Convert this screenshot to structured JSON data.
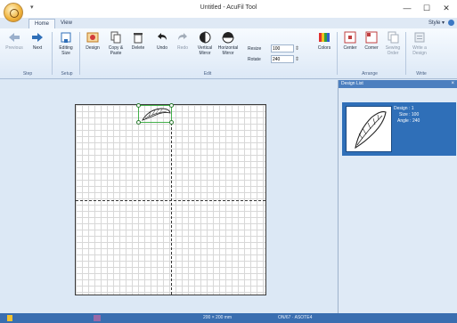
{
  "window": {
    "title": "Untitled - AcuFil Tool",
    "qat": "▾",
    "minimize": "—",
    "maximize": "☐",
    "close": "✕"
  },
  "tabs": [
    {
      "label": "Home"
    },
    {
      "label": "View"
    }
  ],
  "style_menu": "Style ▾",
  "ribbon": {
    "buttons": [
      {
        "label": "Previous",
        "disabled": true
      },
      {
        "label": "Next"
      },
      {
        "label": "Editing Size"
      },
      {
        "label": "Design"
      },
      {
        "label": "Copy & Paste"
      },
      {
        "label": "Delete"
      },
      {
        "label": "Undo"
      },
      {
        "label": "Redo",
        "disabled": true
      },
      {
        "label": "Vertical Mirror"
      },
      {
        "label": "Horizontal Mirror"
      },
      {
        "label": "Colors"
      },
      {
        "label": "Center"
      },
      {
        "label": "Corner"
      },
      {
        "label": "Sewing Order",
        "disabled": true
      },
      {
        "label": "Write a Design",
        "disabled": true
      }
    ],
    "resize": {
      "label": "Resize",
      "value": "100"
    },
    "rotate": {
      "label": "Rotate",
      "value": "240"
    },
    "groups": {
      "step": "Step",
      "setup": "Setup",
      "edit": "Edit",
      "arrange": "Arrange",
      "write": "Write"
    }
  },
  "design_list": {
    "title": "Design List",
    "close": "×",
    "item": {
      "design": "Design : 1",
      "size": "Size : 100",
      "angle": "Angle : 240"
    }
  },
  "status": {
    "hoop": "200 × 200 mm",
    "position": "ON/67 · ASOTE4"
  },
  "colors": {
    "accent": "#2f6fb8",
    "selection": "#43b04a"
  }
}
